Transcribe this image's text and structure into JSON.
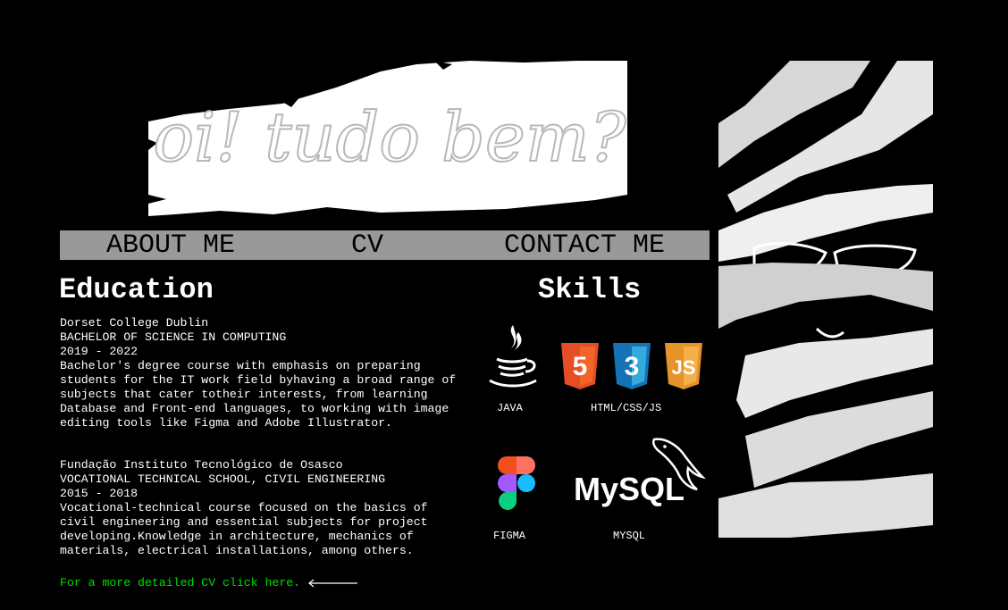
{
  "banner": {
    "text": "oi! tudo bem?"
  },
  "nav": {
    "about": "ABOUT ME",
    "cv": "CV",
    "contact": "CONTACT ME"
  },
  "education": {
    "title": "Education",
    "items": [
      {
        "school": "Dorset College Dublin",
        "degree": "BACHELOR OF SCIENCE IN COMPUTING",
        "years": "2019 - 2022",
        "description": "Bachelor's degree course with emphasis on preparing students for the IT work field byhaving a broad range of subjects that cater totheir interests, from learning Database and Front-end languages, to working with image editing tools like Figma and Adobe Illustrator."
      },
      {
        "school": "Fundação Instituto Tecnológico de Osasco",
        "degree": "VOCATIONAL TECHNICAL SCHOOL, CIVIL ENGINEERING",
        "years": "2015 - 2018",
        "description": "Vocational-technical course focused on the basics of civil engineering and essential subjects for project developing.Knowledge in architecture, mechanics of materials, electrical installations, among others."
      }
    ],
    "cv_link": "For a more detailed CV click here."
  },
  "skills": {
    "title": "Skills",
    "items": [
      {
        "label": "JAVA",
        "icon": "java-icon"
      },
      {
        "label": "HTML/CSS/JS",
        "icon": "html-css-js-icons"
      },
      {
        "label": "FIGMA",
        "icon": "figma-icon"
      },
      {
        "label": "MYSQL",
        "icon": "mysql-icon"
      }
    ],
    "html_badge": "5",
    "css_badge": "3",
    "js_badge": "JS",
    "mysql_logo": "MySQL"
  },
  "colors": {
    "background": "#000000",
    "nav_bar": "#999999",
    "link": "#00e000",
    "html": "#e44d26",
    "css": "#1572b6",
    "js": "#f0a030"
  }
}
